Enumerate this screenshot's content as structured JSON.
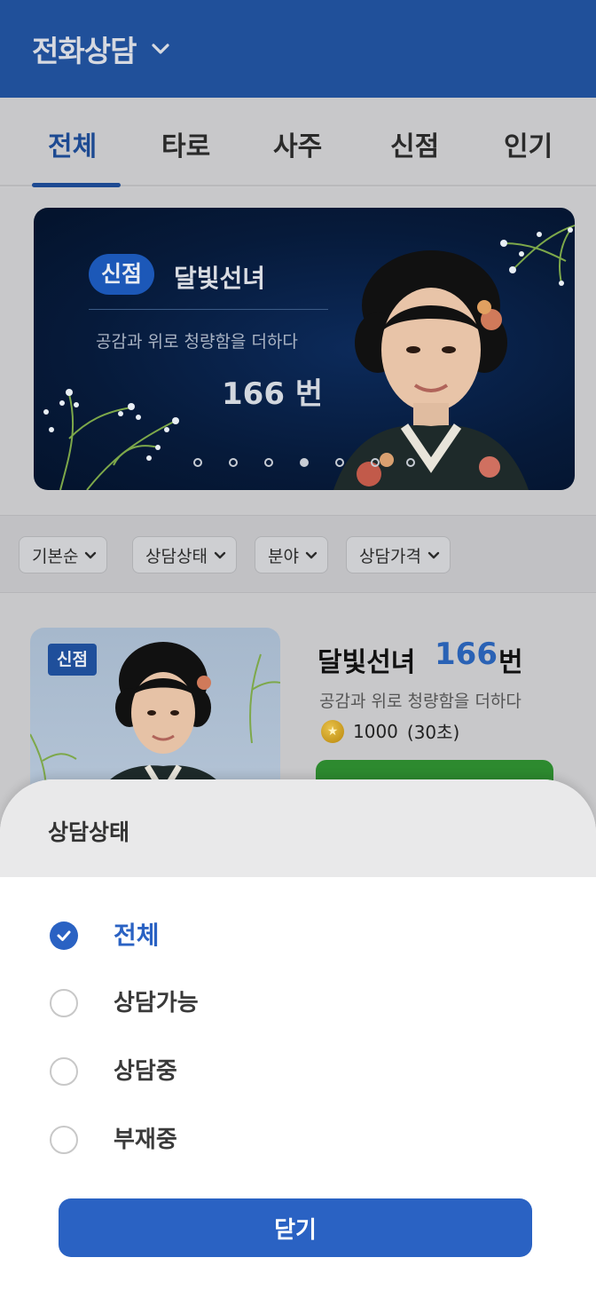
{
  "header": {
    "title": "전화상담"
  },
  "tabs": [
    {
      "label": "전체",
      "active": true
    },
    {
      "label": "타로",
      "active": false
    },
    {
      "label": "사주",
      "active": false
    },
    {
      "label": "신점",
      "active": false
    },
    {
      "label": "인기",
      "active": false
    }
  ],
  "banner": {
    "badge": "신점",
    "name": "달빛선녀",
    "description": "공감과 위로 청량함을 더하다",
    "number": "166 번",
    "page_count": 7,
    "active_page": 4
  },
  "filters": [
    {
      "label": "기본순"
    },
    {
      "label": "상담상태"
    },
    {
      "label": "분야"
    },
    {
      "label": "상담가격"
    }
  ],
  "card": {
    "badge": "신점",
    "name": "달빛선녀",
    "number": "166",
    "unit": "번",
    "description": "공감과 위로 청량함을 더하다",
    "price": "1000",
    "duration": "(30초)"
  },
  "sheet": {
    "title": "상담상태",
    "options": [
      {
        "label": "전체",
        "selected": true
      },
      {
        "label": "상담가능",
        "selected": false
      },
      {
        "label": "상담중",
        "selected": false
      },
      {
        "label": "부재중",
        "selected": false
      }
    ],
    "close_label": "닫기"
  },
  "colors": {
    "brand": "#20509a",
    "accent": "#2a62c3",
    "call_button": "#2d8a2f"
  }
}
